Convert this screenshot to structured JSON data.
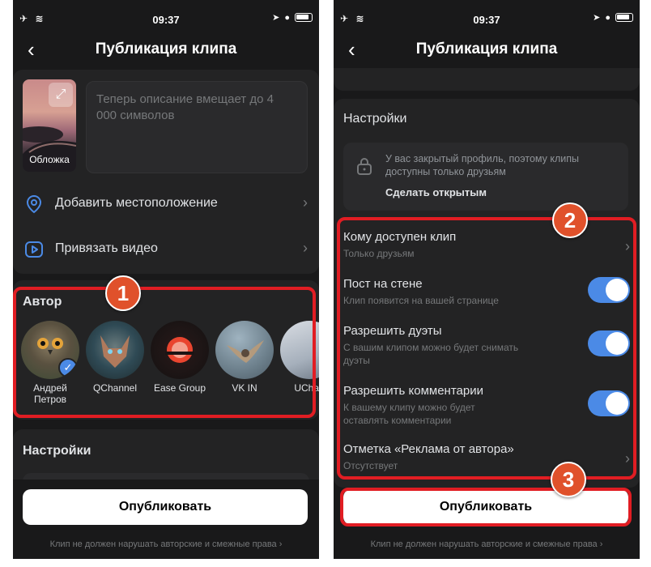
{
  "status": {
    "time": "09:37"
  },
  "left": {
    "title": "Публикация клипа",
    "cover_label": "Обложка",
    "description_placeholder": "Теперь описание вмещает до 4 000 символов",
    "rows": [
      {
        "label": "Добавить местоположение",
        "icon": "location-pin-icon"
      },
      {
        "label": "Привязать видео",
        "icon": "play-square-icon"
      }
    ],
    "author_title": "Автор",
    "authors": [
      {
        "name": "Андрей Петров",
        "selected": true
      },
      {
        "name": "QChannel",
        "selected": false
      },
      {
        "name": "Ease Group",
        "selected": false
      },
      {
        "name": "VK IN",
        "selected": false
      },
      {
        "name": "UChan",
        "selected": false
      }
    ],
    "settings_title": "Настройки",
    "publish_label": "Опубликовать",
    "footer": "Клип не должен нарушать авторские и смежные права ›",
    "marker": "1"
  },
  "right": {
    "title": "Публикация клипа",
    "settings_title": "Настройки",
    "locked_text": "У вас закрытый профиль, поэтому клипы доступны только друзьям",
    "locked_link": "Сделать открытым",
    "options": [
      {
        "title": "Кому доступен клип",
        "subtitle": "Только друзьям",
        "control": "chevron"
      },
      {
        "title": "Пост на стене",
        "subtitle": "Клип появится на вашей странице",
        "control": "toggle",
        "on": true
      },
      {
        "title": "Разрешить дуэты",
        "subtitle": "С вашим клипом можно будет снимать дуэты",
        "control": "toggle",
        "on": true
      },
      {
        "title": "Разрешить комментарии",
        "subtitle": "К вашему клипу можно будет оставлять комментарии",
        "control": "toggle",
        "on": true
      },
      {
        "title": "Отметка «Реклама от автора»",
        "subtitle": "Отсутствует",
        "control": "chevron"
      }
    ],
    "publish_label": "Опубликовать",
    "footer": "Клип не должен нарушать авторские и смежные права ›",
    "marker_2": "2",
    "marker_3": "3"
  },
  "colors": {
    "accent": "#4b8ae6",
    "highlight": "#e11d23",
    "marker": "#e0512b",
    "background": "#19191a",
    "card": "#232324"
  }
}
